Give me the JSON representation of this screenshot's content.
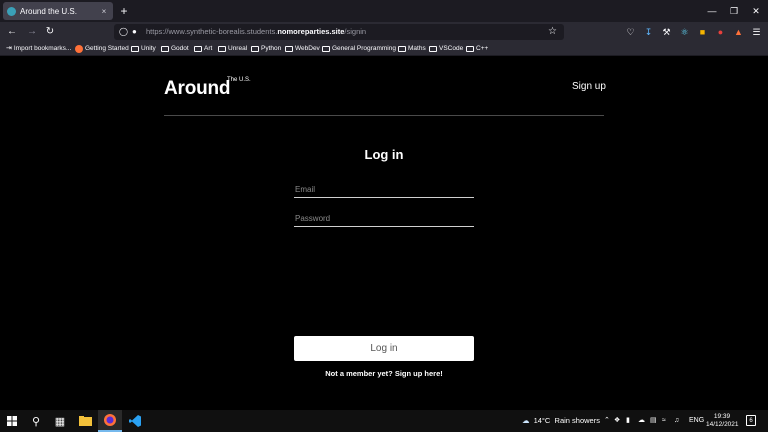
{
  "browser": {
    "tab_title": "Around the U.S.",
    "tab_close": "×",
    "new_tab": "+",
    "window_controls": [
      "—",
      "❐",
      "✕"
    ],
    "url_prefix": "https://www.synthetic-borealis.students.",
    "url_domain": "nomoreparties.site",
    "url_path": "/signin",
    "bookmarks": [
      {
        "label": "Import bookmarks...",
        "icon": "import-icon"
      },
      {
        "label": "Getting Started",
        "icon": "firefox-icon"
      },
      {
        "label": "Unity",
        "icon": "folder-icon"
      },
      {
        "label": "Godot",
        "icon": "folder-icon"
      },
      {
        "label": "Art",
        "icon": "folder-icon"
      },
      {
        "label": "Unreal",
        "icon": "folder-icon"
      },
      {
        "label": "Python",
        "icon": "folder-icon"
      },
      {
        "label": "WebDev",
        "icon": "folder-icon"
      },
      {
        "label": "General Programming",
        "icon": "folder-icon"
      },
      {
        "label": "Maths",
        "icon": "folder-icon"
      },
      {
        "label": "VSCode",
        "icon": "folder-icon"
      },
      {
        "label": "C++",
        "icon": "folder-icon"
      }
    ]
  },
  "header": {
    "logo": "Around",
    "logo_sup": "The U.S.",
    "signup": "Sign up"
  },
  "form": {
    "title": "Log in",
    "email_placeholder": "Email",
    "password_placeholder": "Password",
    "submit": "Log in",
    "member_link": "Not a member yet? Sign up here!"
  },
  "taskbar": {
    "weather_temp": "14°C",
    "weather_desc": "Rain showers",
    "language": "ENG",
    "time": "19:39",
    "date": "14/12/2021",
    "notification_count": "6"
  },
  "colors": {
    "page_bg": "#000000",
    "text": "#ffffff",
    "button_bg": "#ffffff",
    "browser_chrome": "#2b2a33"
  }
}
